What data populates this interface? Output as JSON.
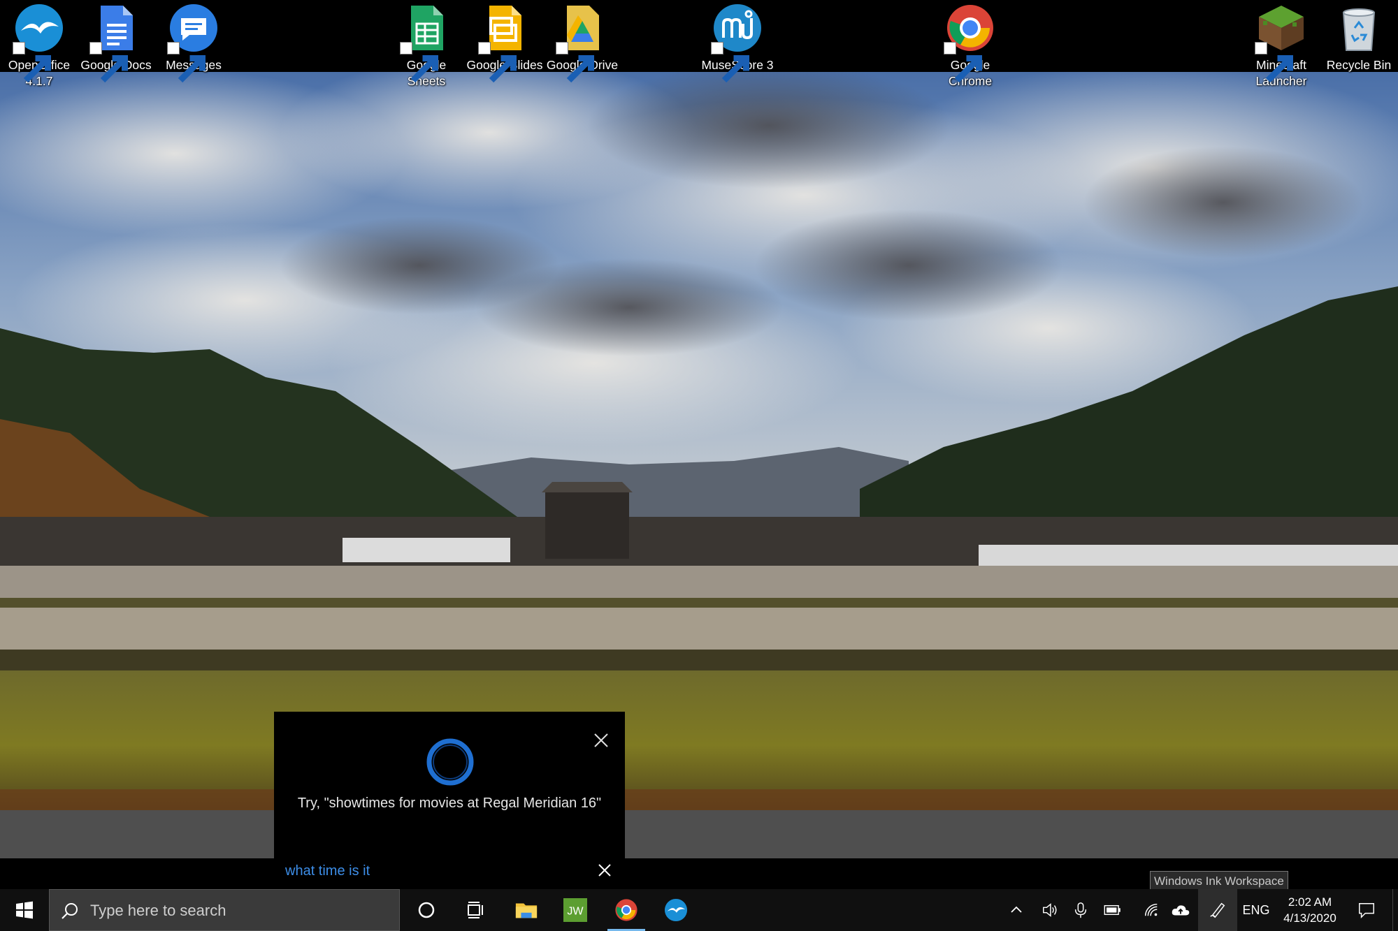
{
  "desktop": {
    "icons": [
      {
        "label": "OpenOffice 4.1.7",
        "icon": "openoffice-icon"
      },
      {
        "label": "Google Docs",
        "icon": "google-docs-icon"
      },
      {
        "label": "Messages",
        "icon": "messages-icon"
      },
      {
        "label": "Google Sheets",
        "icon": "google-sheets-icon"
      },
      {
        "label": "Google Slides",
        "icon": "google-slides-icon"
      },
      {
        "label": "Google Drive",
        "icon": "google-drive-icon"
      },
      {
        "label": "MuseScore 3",
        "icon": "musescore-icon"
      },
      {
        "label": "Google Chrome",
        "icon": "google-chrome-icon"
      },
      {
        "label": "Minecraft Launcher",
        "icon": "minecraft-icon"
      },
      {
        "label": "Recycle Bin",
        "icon": "recycle-bin-icon"
      }
    ]
  },
  "cortana": {
    "hint": "Try, \"showtimes for movies at Regal Meridian 16\"",
    "query": "what time is it"
  },
  "tooltip": {
    "text": "Windows Ink Workspace"
  },
  "taskbar": {
    "search_placeholder": "Type here to search",
    "pinned_apps": [
      "file-explorer-icon",
      "jw-app-icon",
      "google-chrome-icon",
      "openoffice-icon"
    ],
    "language": "ENG",
    "time": "2:02 AM",
    "date": "4/13/2020"
  },
  "colors": {
    "cortana_ring": "#1f6fd1",
    "query_text": "#3d8ee8",
    "taskbar": "#101010",
    "active_indicator": "#76b9ed"
  }
}
